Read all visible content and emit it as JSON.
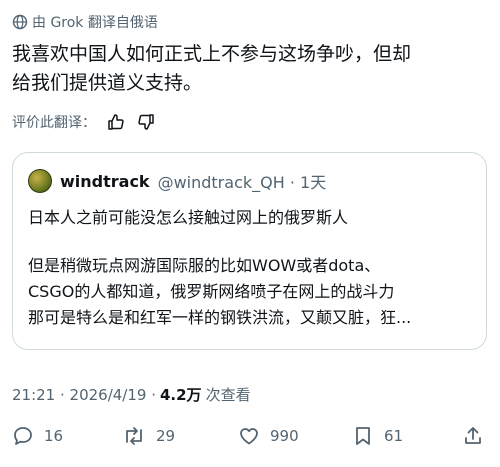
{
  "translation": {
    "note": "由 Grok 翻译自俄语",
    "icon": "globe-icon"
  },
  "tweet": {
    "text_line1": "我喜欢中国人如何正式上不参与这场争吵，但却",
    "text_line2": "给我们提供道义支持。"
  },
  "rating": {
    "label": "评价此翻译：",
    "thumbs_up_icon": "thumbs-up-icon",
    "thumbs_down_icon": "thumbs-down-icon"
  },
  "quote": {
    "name": "windtrack",
    "handle_time": "@windtrack_QH · 1天",
    "line1": "日本人之前可能没怎么接触过网上的俄罗斯人",
    "line2": "但是稍微玩点网游国际服的比如WOW或者dota、",
    "line3": "CSGO的人都知道，俄罗斯网络喷子在网上的战斗力",
    "line4": "那可是特么是和红军一样的钢铁洪流，又颠又脏，狂..."
  },
  "meta": {
    "time_date": "21:21 · 2026/4/19 ·",
    "views_count": "4.2万",
    "views_label": "次查看"
  },
  "actions": {
    "replies": "16",
    "reposts": "29",
    "likes": "990",
    "bookmarks": "61"
  },
  "colors": {
    "text": "#0f1419",
    "secondary": "#536471",
    "border": "#cfd9de"
  }
}
